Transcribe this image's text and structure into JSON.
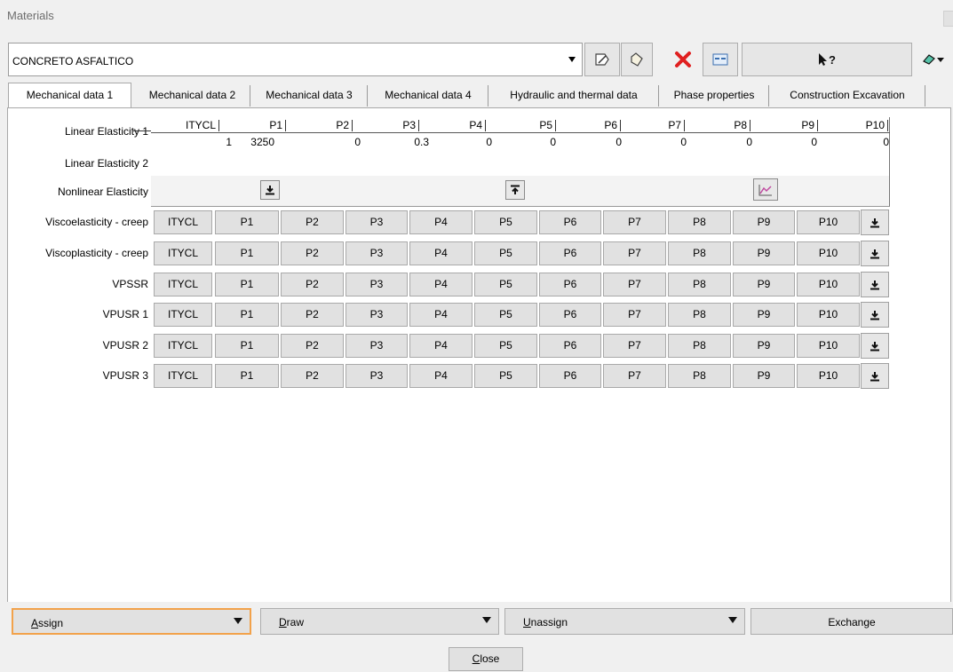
{
  "window": {
    "title": "Materials"
  },
  "material": {
    "selected": "CONCRETO ASFALTICO"
  },
  "tabs": [
    {
      "label": "Mechanical data 1",
      "active": true
    },
    {
      "label": "Mechanical data 2"
    },
    {
      "label": "Mechanical data 3"
    },
    {
      "label": "Mechanical data 4"
    },
    {
      "label": "Hydraulic and thermal data"
    },
    {
      "label": "Phase properties"
    },
    {
      "label": "Construction Excavation"
    }
  ],
  "rows": {
    "linear_elasticity_1": "Linear Elasticity 1",
    "linear_elasticity_2": "Linear Elasticity 2",
    "nonlinear_elasticity": "Nonlinear Elasticity",
    "viscoelasticity": "Viscoelasticity - creep",
    "viscoplasticity": "Viscoplasticity - creep",
    "vpssr": "VPSSR",
    "vpusr1": "VPUSR 1",
    "vpusr2": "VPUSR 2",
    "vpusr3": "VPUSR 3"
  },
  "grid": {
    "headers": [
      "ITYCL",
      "P1",
      "P2",
      "P3",
      "P4",
      "P5",
      "P6",
      "P7",
      "P8",
      "P9",
      "P10"
    ],
    "values": [
      "1",
      "3250",
      "0",
      "0.3",
      "0",
      "0",
      "0",
      "0",
      "0",
      "0",
      "0"
    ]
  },
  "params": [
    "ITYCL",
    "P1",
    "P2",
    "P3",
    "P4",
    "P5",
    "P6",
    "P7",
    "P8",
    "P9",
    "P10"
  ],
  "bottom": {
    "assign": "ssign",
    "assign_mn": "A",
    "draw": "raw",
    "draw_mn": "D",
    "unassign": "nassign",
    "unassign_mn": "U",
    "exchange": "Exchange",
    "close": "lose",
    "close_mn": "C"
  },
  "help_glyph": "?",
  "colors": {
    "focus_border": "#f2a24b",
    "delete_x": "#e02020"
  }
}
